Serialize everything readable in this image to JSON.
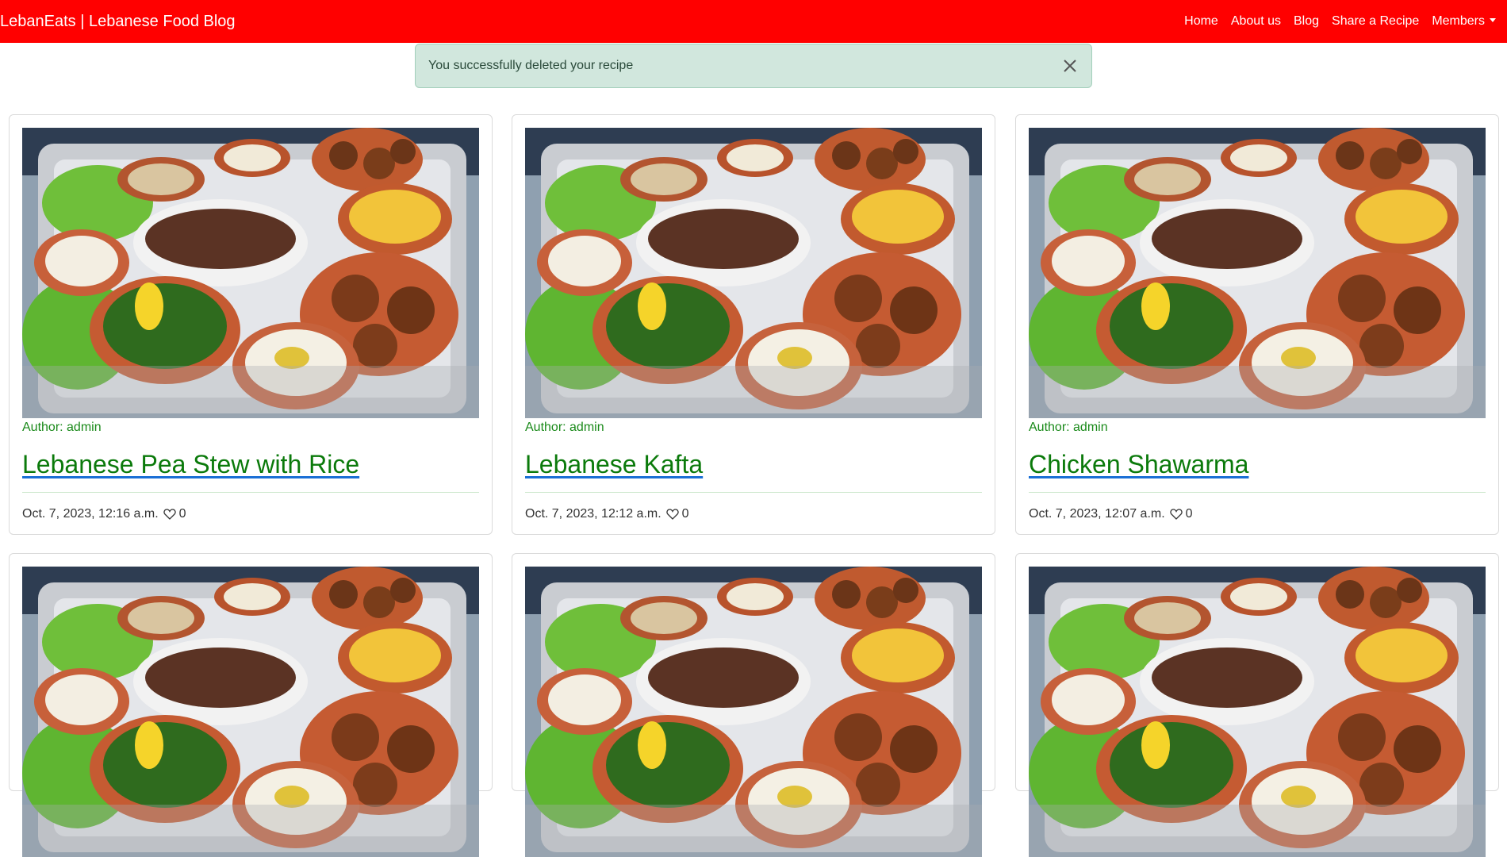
{
  "navbar": {
    "brand": "LebanEats | Lebanese Food Blog",
    "links": [
      "Home",
      "About us",
      "Blog",
      "Share a Recipe"
    ],
    "members": "Members"
  },
  "alert": {
    "message": "You successfully deleted your recipe"
  },
  "posts": [
    {
      "author": "Author: admin",
      "title": "Lebanese Pea Stew with Rice",
      "date": "Oct. 7, 2023, 12:16 a.m.",
      "likes": "0"
    },
    {
      "author": "Author: admin",
      "title": "Lebanese Kafta",
      "date": "Oct. 7, 2023, 12:12 a.m.",
      "likes": "0"
    },
    {
      "author": "Author: admin",
      "title": "Chicken Shawarma",
      "date": "Oct. 7, 2023, 12:07 a.m.",
      "likes": "0"
    }
  ],
  "icons": {
    "close": "close-icon",
    "heart": "heart-icon",
    "dropdown": "chevron-down-icon"
  },
  "colors": {
    "navbar": "#ff0000",
    "alert_bg": "#d1e7dd",
    "link_green": "#0b7a0b"
  }
}
